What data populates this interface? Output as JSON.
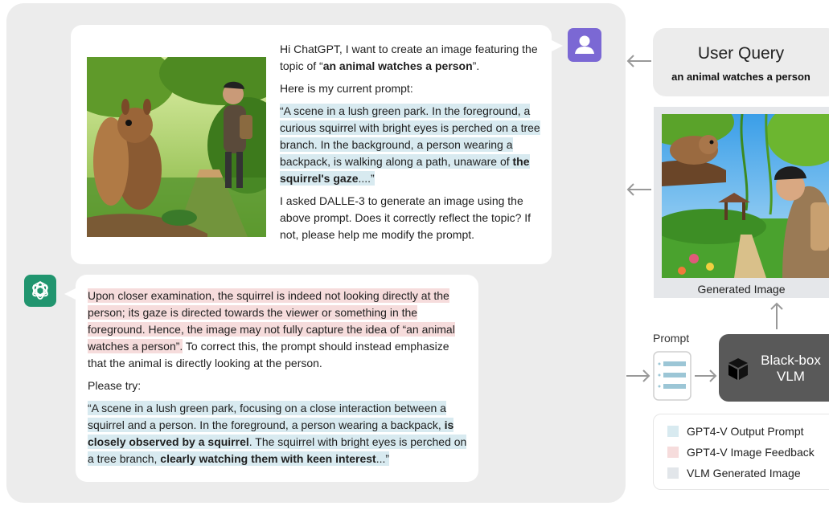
{
  "conversation": {
    "user_message": {
      "line1": "Hi ChatGPT, I want to create an image featuring the topic of “",
      "topic": "an animal watches a person",
      "line1_end": "”.",
      "intro": "Here is my current prompt:",
      "prompt_text": "“A scene in a lush green park. In the foreground, a curious squirrel with bright eyes is perched on a tree branch. In the background, a person wearing a backpack, is walking along a path, unaware of ",
      "prompt_bold": "the squirrel's gaze",
      "prompt_end": "....”",
      "question": "I asked DALLE-3 to generate an image using the above prompt. Does it correctly reflect the topic? If not, please help me modify the prompt."
    },
    "bot_message": {
      "feedback_highlight": "Upon closer examination, the squirrel is indeed not looking directly at the person; its gaze is directed towards the viewer or something in the foreground. Hence, the image may not fully capture the idea of “an animal watches a person”.",
      "feedback_rest": " To correct this, the prompt should instead emphasize that the animal is directly looking at the person.",
      "please_try": "Please try:",
      "new_prompt_start": "“A scene in a lush green park, focusing on a close interaction between a squirrel and a person. In the foreground, a person wearing a backpack, ",
      "new_prompt_bold1": "is closely observed by a squirrel",
      "new_prompt_mid": ". The squirrel with bright eyes is perched on a tree branch, ",
      "new_prompt_bold2": "clearly watching them with keen interest",
      "new_prompt_end": "...”"
    }
  },
  "user_query": {
    "title": "User Query",
    "text": "an animal watches a person"
  },
  "generated_image": {
    "caption": "Generated Image"
  },
  "prompt_label": "Prompt",
  "vlm": {
    "label_line1": "Black-box",
    "label_line2": "VLM"
  },
  "legend": [
    {
      "label": "GPT4-V Output Prompt",
      "color": "#d8eaf0"
    },
    {
      "label": "GPT4-V Image Feedback",
      "color": "#f6dcdc"
    },
    {
      "label": "VLM Generated Image",
      "color": "#e2e6ea"
    }
  ],
  "colors": {
    "panel": "#ececec",
    "avatar": "#7b68d4",
    "gpt_logo": "#21956f",
    "vlm_box": "#595959"
  },
  "icons": [
    "person-icon",
    "openai-logo-icon",
    "prompt-document-icon",
    "cube-icon",
    "arrow-left-icon",
    "arrow-right-icon",
    "arrow-up-icon"
  ]
}
